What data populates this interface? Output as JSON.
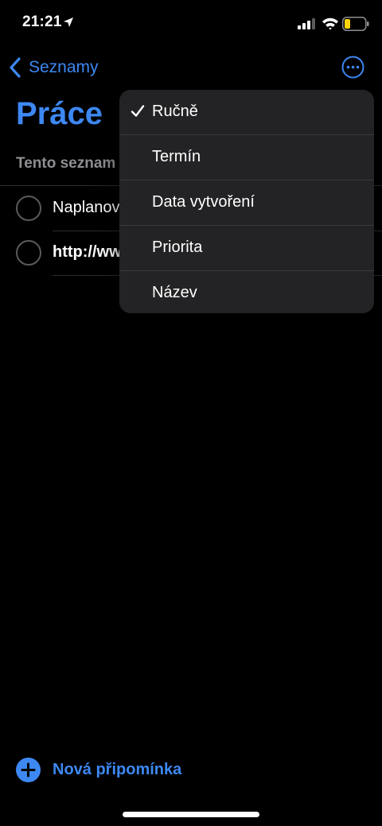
{
  "status_bar": {
    "time": "21:21"
  },
  "nav": {
    "back_label": "Seznamy"
  },
  "page": {
    "title": "Práce",
    "section_note": "Tento seznam"
  },
  "tasks": [
    {
      "text": "Naplanov"
    },
    {
      "text": "http://ww"
    }
  ],
  "sort_menu": {
    "items": [
      {
        "label": "Ručně",
        "checked": true
      },
      {
        "label": "Termín",
        "checked": false
      },
      {
        "label": "Data vytvoření",
        "checked": false
      },
      {
        "label": "Priorita",
        "checked": false
      },
      {
        "label": "Název",
        "checked": false
      }
    ]
  },
  "footer": {
    "new_reminder_label": "Nová připomínka"
  },
  "colors": {
    "accent": "#3d88f3",
    "background": "#000000",
    "menu_background": "#232325",
    "battery_low": "#ffd60a"
  }
}
